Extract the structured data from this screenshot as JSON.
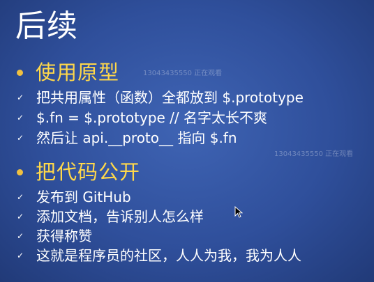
{
  "slide": {
    "title": "后续",
    "sections": [
      {
        "heading": "使用原型",
        "items": [
          "把共用属性（函数）全都放到 $.prototype",
          "$.fn = $.prototype // 名字太长不爽",
          "然后让 api.__proto__ 指向 $.fn"
        ]
      },
      {
        "heading": "把代码公开",
        "items": [
          "发布到 GitHub",
          "添加文档，告诉别人怎么样",
          "获得称赞",
          "这就是程序员的社区，人人为我，我为人人"
        ]
      }
    ],
    "check_mark": "✓"
  },
  "watermarks": [
    "13043435550 正在观看",
    "13043435550 正在观看"
  ],
  "colors": {
    "background": "#2f4f9b",
    "heading": "#ffd84a",
    "text": "#ffffff"
  }
}
